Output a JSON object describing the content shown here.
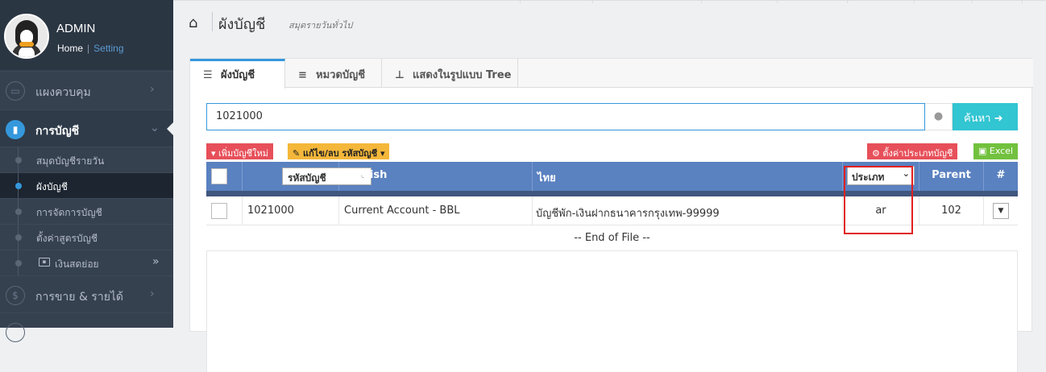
{
  "sidebar": {
    "user_name": "ADMIN",
    "link_home": "Home",
    "link_sep": "|",
    "link_setting": "Setting",
    "items": [
      {
        "label": "แผงควบคุม",
        "icon": "monitor-icon",
        "arrow": "›"
      },
      {
        "label": "การบัญชี",
        "icon": "book-icon",
        "arrow": "⌄"
      }
    ],
    "sub_items": [
      {
        "label": "สมุดบัญชีรายวัน"
      },
      {
        "label": "ผังบัญชี"
      },
      {
        "label": "การจัดการบัญชี"
      },
      {
        "label": "ตั้งค่าสูตรบัญชี"
      },
      {
        "label": "เงินสดย่อย",
        "arrow": "»"
      }
    ],
    "sales": {
      "label": "การขาย & รายได้",
      "icon": "$",
      "arrow": "›"
    }
  },
  "header": {
    "title": "ผังบัญชี",
    "subtitle": "สมุดรายวันทั่วไป"
  },
  "tabs": [
    {
      "label": "ผังบัญชี",
      "icon": "list-icon"
    },
    {
      "label": "หมวดบัญชี",
      "icon": "indent-icon"
    },
    {
      "label": "แสดงในรูปแบบ Tree",
      "icon": "sitemap-icon"
    }
  ],
  "search": {
    "value": "1021000",
    "button_label": "ค้นหา"
  },
  "toolbar": {
    "new_label": "เพิ่มบัญชีใหม่",
    "edit_label": "แก้ไข/ลบ รหัสบัญชี",
    "settype_label": "ตั้งค่าประเภทบัญชี",
    "excel_label": "Excel"
  },
  "table": {
    "headers": {
      "code_select": "รหัสบัญชี",
      "english": "English",
      "thai": "ไทย",
      "type_select": "ประเภท",
      "parent": "Parent",
      "hash": "#"
    },
    "rows": [
      {
        "code": "1021000",
        "english": "Current Account - BBL",
        "thai": "บัญชีพัก-เงินฝากธนาคารกรุงเทพ-99999",
        "type": "ar",
        "parent": "102"
      }
    ],
    "eof": "-- End of File --"
  },
  "colors": {
    "sidebar_bg": "#364150",
    "accent": "#3598dc",
    "table_header": "#5a81c0",
    "search_button": "#32c5d2",
    "highlight": "#e02020"
  }
}
